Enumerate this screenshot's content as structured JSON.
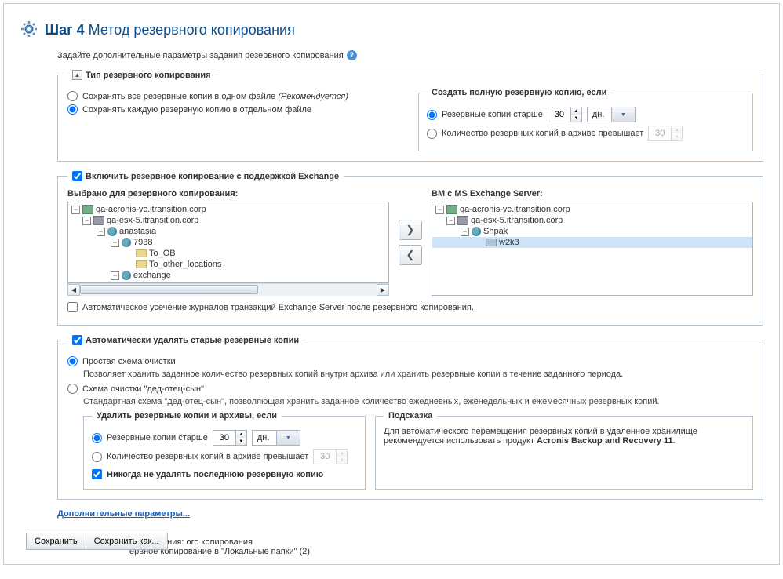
{
  "header": {
    "step": "Шаг 4",
    "title": "Метод резервного копирования"
  },
  "subtitle": "Задайте дополнительные параметры задания резервного копирования",
  "backupType": {
    "legend": "Тип резервного копирования",
    "optSingle": "Сохранять все резервные копии в одном файле",
    "optSingleHint": "(Рекомендуется)",
    "optSeparate": "Сохранять каждую резервную копию в отдельном файле",
    "fullCopy": {
      "legend": "Создать полную резервную копию, если",
      "optOlder": "Резервные копии старше",
      "olderValue": "30",
      "olderUnit": "дн.",
      "optCount": "Количество резервных копий в архиве превышает",
      "countValue": "30"
    }
  },
  "exchange": {
    "legend": "Включить резервное копирование с поддержкой Exchange",
    "leftLabel": "Выбрано для резервного копирования:",
    "rightLabel": "ВМ с MS Exchange Server:",
    "leftTree": {
      "n0": "qa-acronis-vc.itransition.corp",
      "n1": "qa-esx-5.itransition.corp",
      "n2": "anastasia",
      "n3": "7938",
      "n4": "To_OB",
      "n5": "To_other_locations",
      "n6": "exchange"
    },
    "rightTree": {
      "n0": "qa-acronis-vc.itransition.corp",
      "n1": "qa-esx-5.itransition.corp",
      "n2": "Shpak",
      "n3": "w2k3"
    },
    "truncateLabel": "Автоматическое усечение журналов транзакций Exchange Server после резервного копирования."
  },
  "cleanup": {
    "legend": "Автоматически удалять старые резервные копии",
    "simple": "Простая схема очистки",
    "simpleDesc": "Позволяет хранить заданное количество резервных копий внутри архива или хранить резервные копии в течение заданного периода.",
    "gfs": "Схема очистки \"дед-отец-сын\"",
    "gfsDesc": "Стандартная схема \"дед-отец-сын\", позволяющая хранить заданное количество ежедневных, еженедельных и ежемесячных резервных копий.",
    "deleteBox": {
      "legend": "Удалить резервные копии и архивы, если",
      "optOlder": "Резервные копии старше",
      "olderValue": "30",
      "olderUnit": "дн.",
      "optCount": "Количество резервных копий в архиве превышает",
      "countValue": "30",
      "neverDelete": "Никогда не удалять последнюю резервную копию"
    },
    "hint": {
      "title": "Подсказка",
      "text": "Для автоматического перемещения резервных копий в удаленное хранилище рекомендуется использовать продукт",
      "product": "Acronis Backup and Recovery 11"
    }
  },
  "moreLink": "Дополнительные параметры...",
  "buttons": {
    "save": "Сохранить",
    "saveAs": "Сохранить как..."
  },
  "footer": "ервное копирование в \"Локальные папки\" (2)",
  "footerPrefix": "Имя задания: ого копирования"
}
